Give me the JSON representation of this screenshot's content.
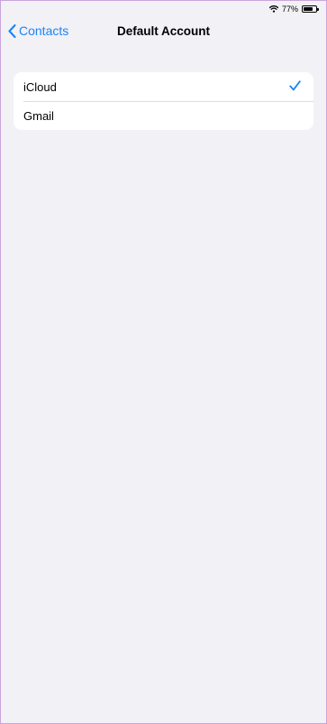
{
  "status_bar": {
    "battery": "77%",
    "battery_level": 0.77,
    "icons": [
      "wifi-icon",
      "battery-icon"
    ]
  },
  "nav": {
    "back_label": "Contacts",
    "back_icon": "chevron-left-icon",
    "title": "Default Account"
  },
  "accounts": {
    "items": [
      {
        "label": "iCloud",
        "selected": true
      },
      {
        "label": "Gmail",
        "selected": false
      }
    ],
    "selected_icon": "checkmark-icon"
  },
  "colors": {
    "accent": "#1a84f7",
    "background": "#f2f1f6",
    "cell": "#ffffff",
    "separator": "#dcdbe0"
  }
}
